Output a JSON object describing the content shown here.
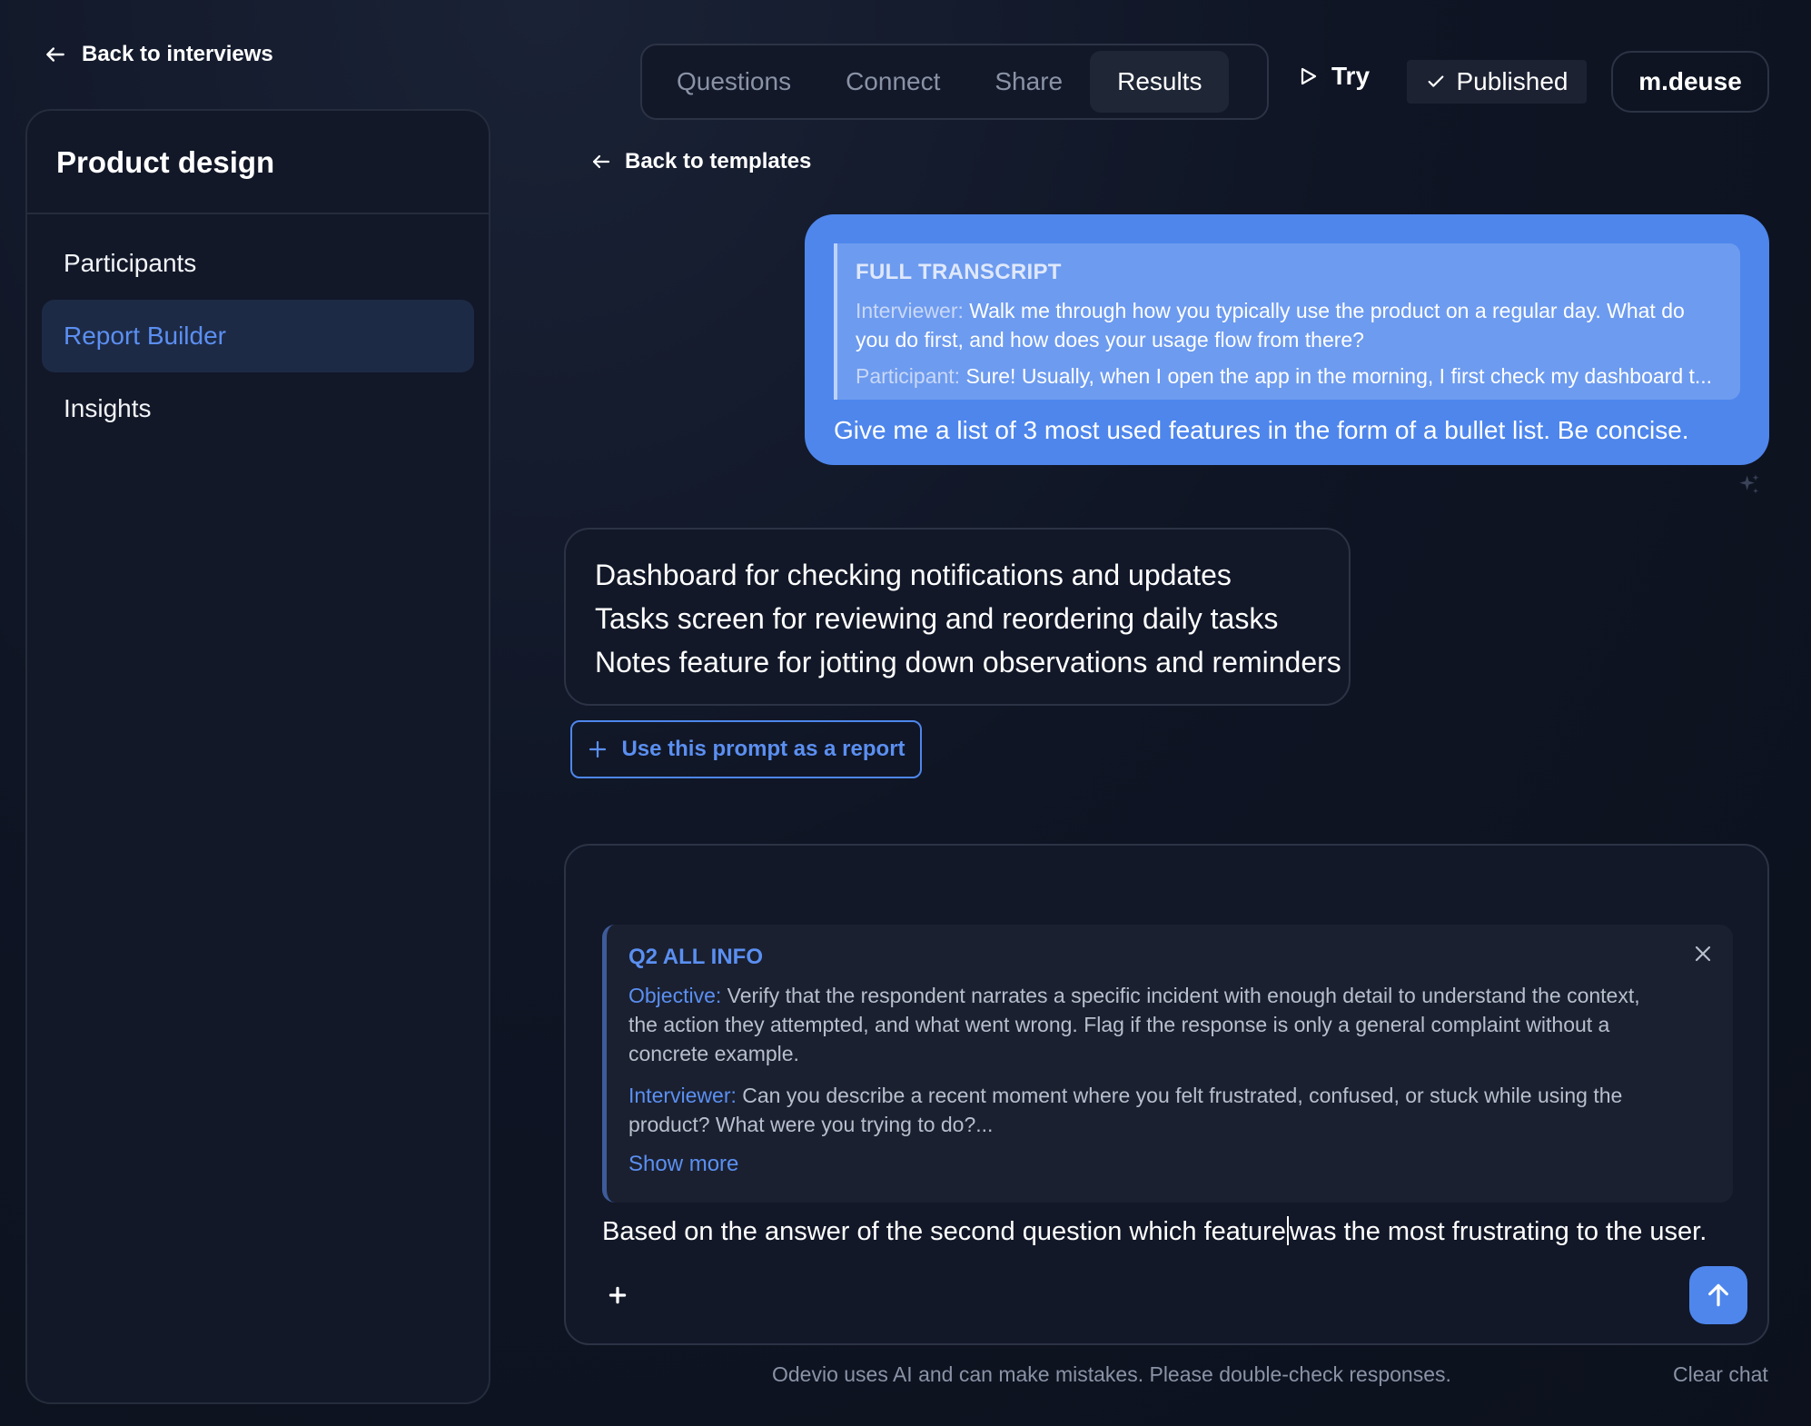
{
  "nav": {
    "back_interviews": "Back to interviews",
    "back_templates": "Back to templates"
  },
  "sidebar": {
    "title": "Product design",
    "items": [
      {
        "label": "Participants",
        "active": false
      },
      {
        "label": "Report Builder",
        "active": true
      },
      {
        "label": "Insights",
        "active": false
      }
    ]
  },
  "tabs": [
    {
      "label": "Questions",
      "active": false
    },
    {
      "label": "Connect",
      "active": false
    },
    {
      "label": "Share",
      "active": false
    },
    {
      "label": "Results",
      "active": true
    }
  ],
  "header": {
    "try_label": "Try",
    "published_label": "Published",
    "user_label": "m.deuse"
  },
  "user_message": {
    "quote_title": "FULL TRANSCRIPT",
    "interviewer_label": "Interviewer:",
    "interviewer_text": "Walk me through how you typically use the product on a regular day. What do you do first, and how does your usage flow from there?",
    "participant_label": "Participant:",
    "participant_text": "Sure! Usually, when I open the app in the morning, I first check my dashboard t...",
    "text": "Give me a list of 3 most used features in the form of a bullet list. Be concise."
  },
  "assistant_message": {
    "lines": [
      "Dashboard for checking notifications and updates",
      "Tasks screen for reviewing and reordering daily tasks",
      "Notes feature for jotting down observations and reminders"
    ]
  },
  "use_prompt_label": "Use this prompt as a report",
  "composer": {
    "context": {
      "title": "Q2 ALL INFO",
      "objective_label": "Objective:",
      "objective_text": "Verify that the respondent narrates a specific incident with enough detail to understand the context, the action they attempted, and what went wrong. Flag if the response is only a general complaint without a concrete example.",
      "interviewer_label": "Interviewer:",
      "interviewer_text": "Can you describe a recent moment where you felt frustrated, confused, or stuck while using the product? What were you trying to do?...",
      "show_more": "Show more"
    },
    "input_before_caret": "Based on the answer of the second question which feature",
    "input_after_caret": "was the most frustrating to the user."
  },
  "footer": {
    "disclaimer": "Odevio uses AI and can make mistakes. Please double-check responses.",
    "clear_chat": "Clear chat"
  },
  "colors": {
    "accent": "#4e86ec",
    "background": "#0d1220",
    "panel": "#121828"
  }
}
